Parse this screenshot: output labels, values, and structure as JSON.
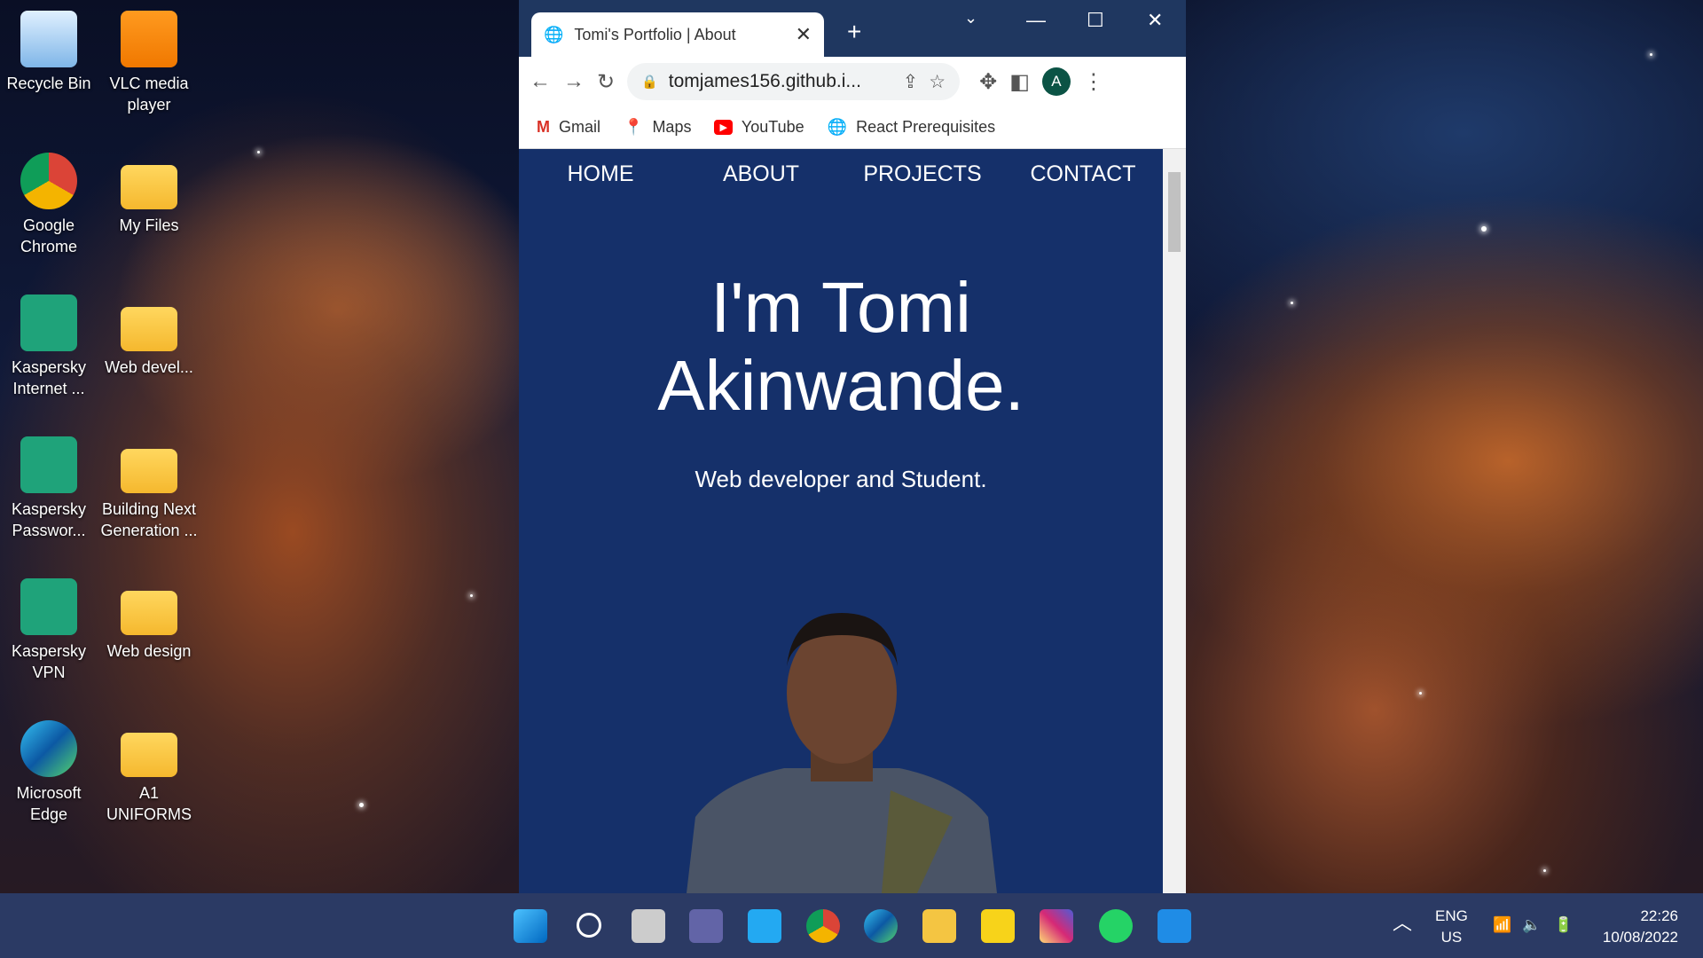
{
  "desktop": {
    "icons": [
      {
        "label": "Recycle Bin",
        "icon": "recycle-bin-icon"
      },
      {
        "label": "VLC media player",
        "icon": "vlc-icon"
      },
      {
        "label": "Google Chrome",
        "icon": "chrome-icon"
      },
      {
        "label": "My Files",
        "icon": "folder-icon"
      },
      {
        "label": "Kaspersky Internet ...",
        "icon": "kaspersky-internet-icon"
      },
      {
        "label": "Web devel...",
        "icon": "folder-icon"
      },
      {
        "label": "Kaspersky Passwor...",
        "icon": "kaspersky-password-icon"
      },
      {
        "label": "Building Next Generation ...",
        "icon": "folder-icon"
      },
      {
        "label": "Kaspersky VPN",
        "icon": "kaspersky-vpn-icon"
      },
      {
        "label": "Web design",
        "icon": "folder-icon"
      },
      {
        "label": "Microsoft Edge",
        "icon": "edge-icon"
      },
      {
        "label": "A1 UNIFORMS",
        "icon": "folder-icon"
      }
    ]
  },
  "browser": {
    "tab_title": "Tomi's Portfolio | About",
    "url": "tomjames156.github.i...",
    "profile_initial": "A",
    "bookmarks": [
      "Gmail",
      "Maps",
      "YouTube",
      "React Prerequisites"
    ]
  },
  "page": {
    "nav": [
      "HOME",
      "ABOUT",
      "PROJECTS",
      "CONTACT"
    ],
    "heading_line1": "I'm Tomi",
    "heading_line2": "Akinwande.",
    "subtitle": "Web developer and Student.",
    "background": "#15306a"
  },
  "taskbar": {
    "apps": [
      "start",
      "search",
      "task-view",
      "teams-chat",
      "vscode",
      "chrome",
      "edge",
      "file-explorer",
      "sticky-notes",
      "instagram",
      "whatsapp",
      "mail"
    ],
    "lang1": "ENG",
    "lang2": "US",
    "time": "22:26",
    "date": "10/08/2022"
  }
}
